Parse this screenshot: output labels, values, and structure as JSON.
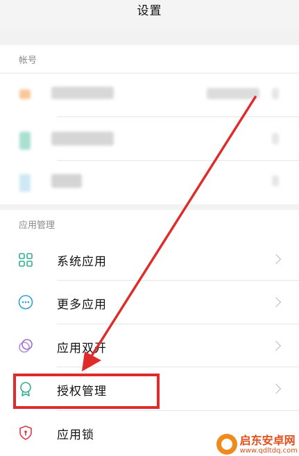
{
  "header": {
    "title": "设置"
  },
  "account": {
    "section_label": "帐号",
    "rows": [
      {
        "swatch": "#f7c79a"
      },
      {
        "swatch": "#a8e0d0"
      },
      {
        "swatch": "#cfe8f5"
      }
    ]
  },
  "apps": {
    "section_label": "应用管理",
    "items": [
      {
        "label": "系统应用",
        "icon": "grid-icon",
        "color": "#2fae8f"
      },
      {
        "label": "更多应用",
        "icon": "more-circle-icon",
        "color": "#2a9fd8"
      },
      {
        "label": "应用双开",
        "icon": "dual-app-icon",
        "color": "#9b6ad1"
      },
      {
        "label": "授权管理",
        "icon": "badge-icon",
        "color": "#2fae8f"
      },
      {
        "label": "应用锁",
        "icon": "shield-lock-icon",
        "color": "#e0364a"
      }
    ]
  },
  "annotation": {
    "highlight_color": "#e02b2b"
  },
  "watermark": {
    "name": "启东安卓网",
    "url": "www.qdltdq.com"
  }
}
